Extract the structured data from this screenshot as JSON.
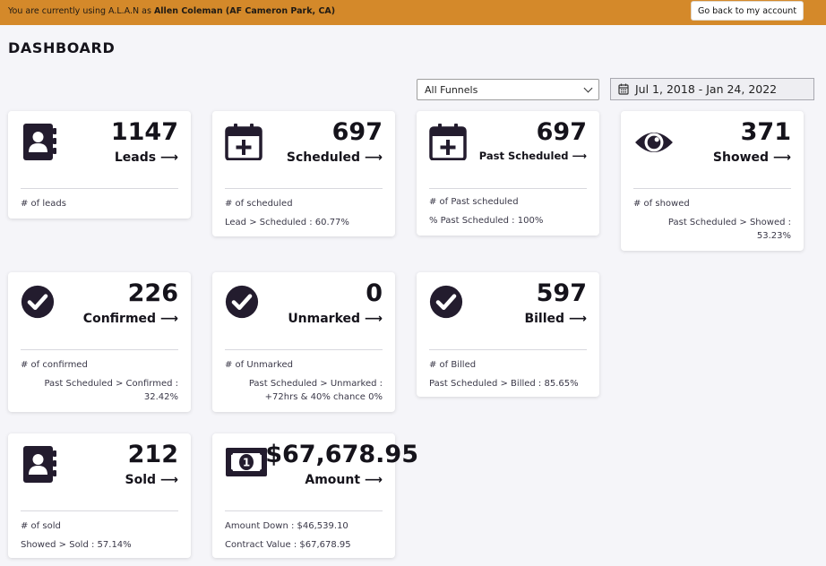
{
  "banner": {
    "prefix": "You are currently using A.L.A.N as ",
    "account": "Allen Coleman (AF Cameron Park, CA)",
    "back_button": "Go back to my account"
  },
  "page_title": "DASHBOARD",
  "filters": {
    "funnel_selected": "All Funnels",
    "date_range": "Jul 1, 2018 - Jan 24, 2022"
  },
  "arrow": "⟶",
  "cards": {
    "leads": {
      "value": "1147",
      "label": "Leads",
      "line1": "# of leads",
      "line2": ""
    },
    "scheduled": {
      "value": "697",
      "label": "Scheduled",
      "line1": "# of scheduled",
      "line2": "Lead > Scheduled : 60.77%"
    },
    "past_scheduled": {
      "value": "697",
      "label": "Past Scheduled",
      "line1": "# of Past scheduled",
      "line2": "% Past Scheduled : 100%"
    },
    "showed": {
      "value": "371",
      "label": "Showed",
      "line1": "# of showed",
      "line2": "Past Scheduled > Showed : 53.23%"
    },
    "confirmed": {
      "value": "226",
      "label": "Confirmed",
      "line1": "# of confirmed",
      "line2": "Past Scheduled > Confirmed : 32.42%"
    },
    "unmarked": {
      "value": "0",
      "label": "Unmarked",
      "line1": "# of Unmarked",
      "line2": "Past Scheduled > Unmarked : +72hrs & 40% chance 0%"
    },
    "billed": {
      "value": "597",
      "label": "Billed",
      "line1": "# of Billed",
      "line2": "Past Scheduled > Billed : 85.65%"
    },
    "sold": {
      "value": "212",
      "label": "Sold",
      "line1": "# of sold",
      "line2": "Showed > Sold : 57.14%"
    },
    "amount": {
      "value": "$67,678.95",
      "label": "Amount",
      "line1": "Amount Down : $46,539.10",
      "line2": "Contract Value : $67,678.95"
    }
  },
  "icons": {
    "contact_book": "contact-book-icon",
    "calendar_plus": "calendar-plus-icon",
    "eye": "eye-icon",
    "check_circle": "check-circle-icon",
    "money": "money-bill-icon",
    "calendar": "calendar-icon"
  },
  "colors": {
    "banner": "#d4892a",
    "icon": "#231c2e",
    "background": "#f5f5f9"
  }
}
